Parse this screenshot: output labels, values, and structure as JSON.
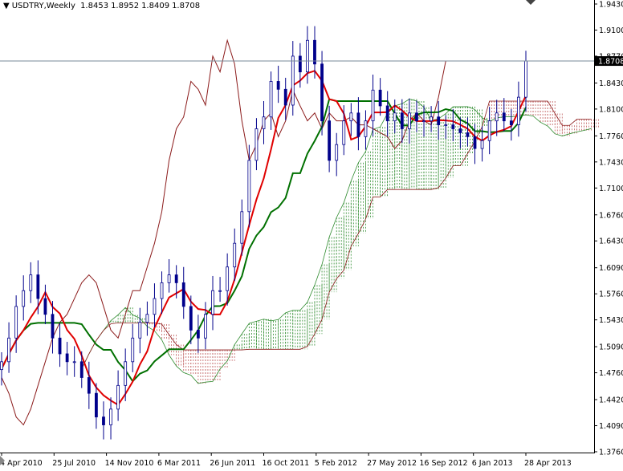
{
  "header": {
    "symbol_timeframe": "USDTRY,Weekly",
    "open": "1.8453",
    "high": "1.8952",
    "low": "1.8409",
    "close": "1.8708"
  },
  "colors": {
    "bull": "#00008b",
    "bear": "#00008b",
    "tenkan": "#e00000",
    "kijun": "#007000",
    "chikou": "#8b1a1a",
    "cloud_up": "#c06060",
    "cloud_down": "#2e8b2e",
    "price_line": "#778899"
  },
  "chart_data": {
    "type": "candlestick-ichimoku",
    "title": "USDTRY,Weekly",
    "current_price": 1.8708,
    "current_price_label": "1.8708",
    "ylim": [
      1.376,
      1.943
    ],
    "y_ticks": [
      "1.9430",
      "1.9100",
      "1.8770",
      "1.8430",
      "1.8100",
      "1.7760",
      "1.7430",
      "1.7100",
      "1.6760",
      "1.6430",
      "1.6090",
      "1.5760",
      "1.5430",
      "1.5090",
      "1.4760",
      "1.4420",
      "1.4090",
      "1.3760"
    ],
    "x_ticks": [
      "4 Apr 2010",
      "25 Jul 2010",
      "14 Nov 2010",
      "6 Mar 2011",
      "26 Jun 2011",
      "16 Oct 2011",
      "5 Feb 2012",
      "27 May 2012",
      "16 Sep 2012",
      "6 Jan 2013",
      "28 Apr 2013"
    ],
    "closes": [
      1.49,
      1.52,
      1.56,
      1.58,
      1.6,
      1.57,
      1.55,
      1.52,
      1.5,
      1.49,
      1.49,
      1.47,
      1.45,
      1.42,
      1.41,
      1.43,
      1.46,
      1.49,
      1.52,
      1.54,
      1.55,
      1.57,
      1.59,
      1.6,
      1.59,
      1.56,
      1.53,
      1.52,
      1.55,
      1.58,
      1.58,
      1.61,
      1.64,
      1.68,
      1.745,
      1.785,
      1.8,
      1.845,
      1.835,
      1.815,
      1.877,
      1.857,
      1.897,
      1.867,
      1.795,
      1.745,
      1.765,
      1.795,
      1.805,
      1.775,
      1.795,
      1.834,
      1.814,
      1.795,
      1.805,
      1.785,
      1.805,
      1.795,
      1.795,
      1.8,
      1.79,
      1.79,
      1.785,
      1.78,
      1.775,
      1.76,
      1.77,
      1.795,
      1.805,
      1.795,
      1.79,
      1.825,
      1.8708
    ],
    "ichimoku_periods": {
      "tenkan": 4,
      "kijun": 11,
      "senkou_b": 22,
      "shift": 11
    }
  }
}
